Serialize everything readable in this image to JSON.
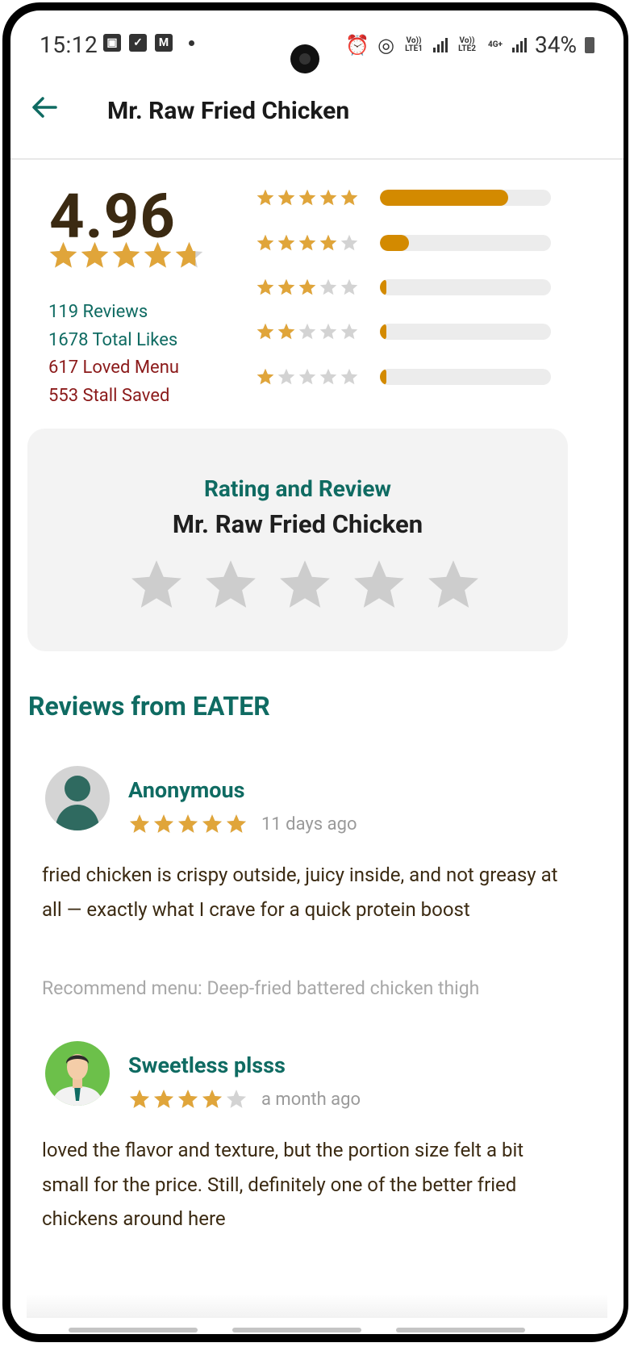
{
  "status_bar": {
    "time": "15:12",
    "battery": "34%",
    "network_1": "Vo)) LTE1",
    "network_2": "Vo)) LTE2",
    "network_3": "4G+"
  },
  "header": {
    "title": "Mr. Raw Fried Chicken"
  },
  "summary": {
    "average": "4.96",
    "average_value": 4.96,
    "reviews": "119 Reviews",
    "likes": "1678 Total Likes",
    "loved": "617 Loved Menu",
    "saved": "553 Stall Saved"
  },
  "distribution": [
    {
      "stars": 5,
      "fraction": 0.75
    },
    {
      "stars": 4,
      "fraction": 0.17
    },
    {
      "stars": 3,
      "fraction": 0.04
    },
    {
      "stars": 2,
      "fraction": 0.02
    },
    {
      "stars": 1,
      "fraction": 0.02
    }
  ],
  "rate_card": {
    "subtitle": "Rating and Review",
    "name": "Mr. Raw Fried Chicken"
  },
  "reviews_section": {
    "title": "Reviews from EATER"
  },
  "reviews": [
    {
      "name": "Anonymous",
      "rating": 5,
      "date": "11 days ago",
      "text": "fried chicken is crispy outside, juicy inside, and not greasy at all — exactly what I crave for a quick protein boost",
      "recommend": "Recommend menu: Deep-fried battered chicken thigh"
    },
    {
      "name": "Sweetless plsss",
      "rating": 4,
      "date": "a month ago",
      "text": "loved the flavor and texture, but the portion size felt a bit small for the price. Still, definitely one of the better fried chickens around here"
    }
  ],
  "colors": {
    "accent": "#0f6b62",
    "star_gold": "#e0a53a",
    "bar_fill": "#d38a00",
    "stat_red": "#8b1a1a"
  }
}
